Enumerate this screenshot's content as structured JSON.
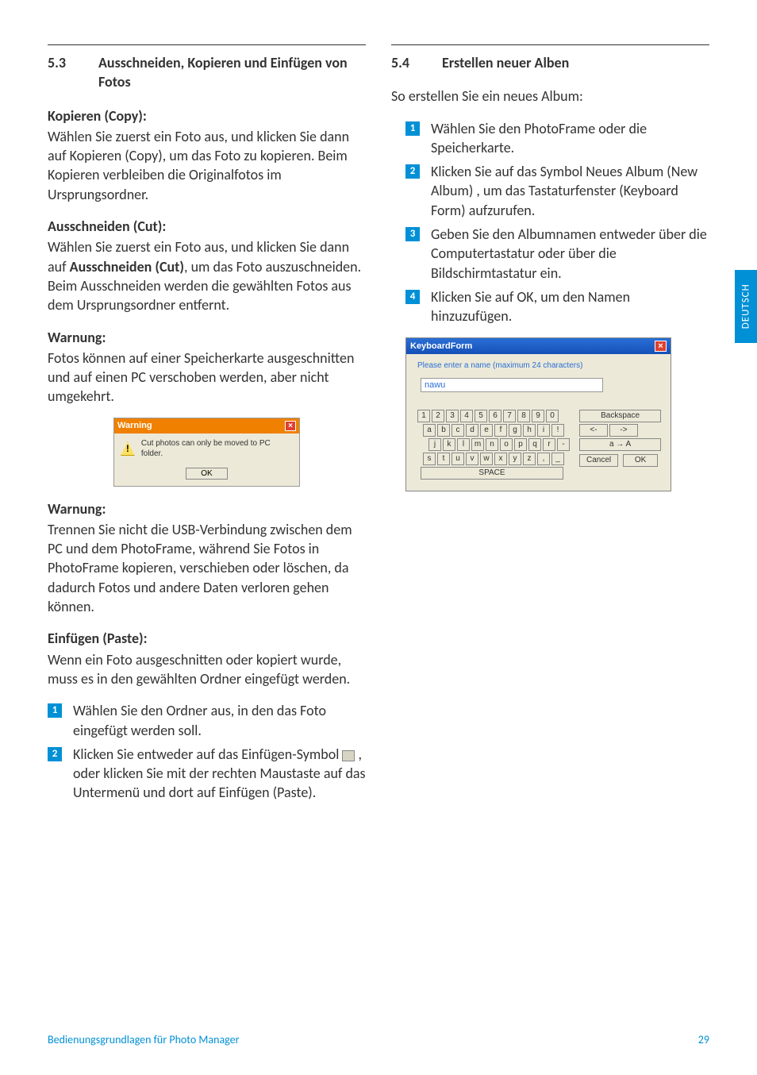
{
  "lang_tab": "DEUTSCH",
  "footer": {
    "left": "Bedienungsgrundlagen für Photo Manager",
    "page": "29"
  },
  "left": {
    "sec_num": "5.3",
    "sec_title": "Ausschneiden, Kopieren und Einfügen von Fotos",
    "copy_head": "Kopieren (Copy):",
    "copy_body": "Wählen Sie zuerst ein Foto aus, und klicken Sie dann auf Kopieren (Copy), um das Foto zu kopieren. Beim Kopieren verbleiben die Originalfotos im Ursprungsordner.",
    "cut_head": "Ausschneiden (Cut):",
    "cut_body_pre": "Wählen Sie zuerst ein Foto aus, und klicken Sie dann auf ",
    "cut_body_bold": "Ausschneiden (Cut)",
    "cut_body_post": ", um das Foto auszuschneiden. Beim Ausschneiden werden die gewählten Fotos aus dem Ursprungsordner entfernt.",
    "warn1_head": "Warnung:",
    "warn1_body": "Fotos können auf einer Speicherkarte ausgeschnitten und auf einen PC verschoben werden, aber nicht umgekehrt.",
    "dialog": {
      "title": "Warning",
      "msg": "Cut photos can only be moved to PC folder.",
      "ok": "OK"
    },
    "warn2_head": "Warnung:",
    "warn2_body": "Trennen Sie nicht die USB-Verbindung zwischen dem PC und dem PhotoFrame, während Sie Fotos in PhotoFrame kopieren, verschieben oder löschen, da dadurch Fotos und andere Daten verloren gehen können.",
    "paste_head": "Einfügen (Paste):",
    "paste_body": "Wenn ein Foto ausgeschnitten oder kopiert wurde, muss es in den gewählten Ordner eingefügt werden.",
    "paste_step1": "Wählen Sie den Ordner aus, in den das Foto eingefügt werden soll.",
    "paste_step2_a": "Klicken Sie entweder auf das Einfügen-Symbol ",
    "paste_step2_b": " , oder klicken Sie mit der rechten Maustaste auf das Untermenü und dort auf Einfügen (Paste)."
  },
  "right": {
    "sec_num": "5.4",
    "sec_title": "Erstellen neuer Alben",
    "intro": "So erstellen Sie ein neues Album:",
    "step1": "Wählen Sie den PhotoFrame oder die Speicherkarte.",
    "step2": "Klicken Sie auf das Symbol Neues Album (New Album)  , um das Tastaturfenster (Keyboard Form) aufzurufen.",
    "step3": "Geben Sie den Albumnamen entweder über die Computertastatur oder über die Bildschirmtastatur ein.",
    "step4": "Klicken Sie auf OK, um den Namen hinzuzufügen.",
    "kb": {
      "title": "KeyboardForm",
      "prompt": "Please enter a name (maximum 24 characters)",
      "input": "nawu",
      "row1": [
        "1",
        "2",
        "3",
        "4",
        "5",
        "6",
        "7",
        "8",
        "9",
        "0"
      ],
      "row2": [
        "a",
        "b",
        "c",
        "d",
        "e",
        "f",
        "g",
        "h",
        "i",
        "!"
      ],
      "row3": [
        "j",
        "k",
        "l",
        "m",
        "n",
        "o",
        "p",
        "q",
        "r",
        "-"
      ],
      "row4": [
        "s",
        "t",
        "u",
        "v",
        "w",
        "x",
        "y",
        "z",
        ",",
        "_"
      ],
      "space": "SPACE",
      "backspace": "Backspace",
      "left": "<-",
      "rightArrow": "->",
      "shift": "a → A",
      "cancel": "Cancel",
      "ok": "OK"
    }
  }
}
